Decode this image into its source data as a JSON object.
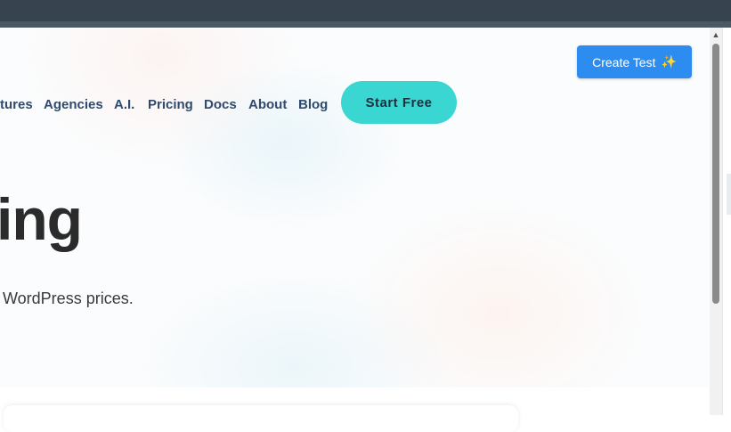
{
  "header": {
    "create_test": {
      "label": "Create Test",
      "icon": "sparkle-icon",
      "icon_glyph": "✨"
    }
  },
  "nav": {
    "items": [
      {
        "label": "tures"
      },
      {
        "label": "Agencies"
      },
      {
        "label": "A.I."
      },
      {
        "label": "Pricing"
      },
      {
        "label": "Docs"
      },
      {
        "label": "About"
      },
      {
        "label": "Blog"
      }
    ],
    "cta": {
      "label": "Start Free"
    }
  },
  "hero": {
    "heading": "ing",
    "subtext": "WordPress prices."
  },
  "scrollbar": {
    "up_arrow": "▲"
  },
  "colors": {
    "accent": "#2d8cf0",
    "cta": "#3ad6d1",
    "nav_text": "#2f4a6d",
    "top_bar": "#37444f"
  }
}
